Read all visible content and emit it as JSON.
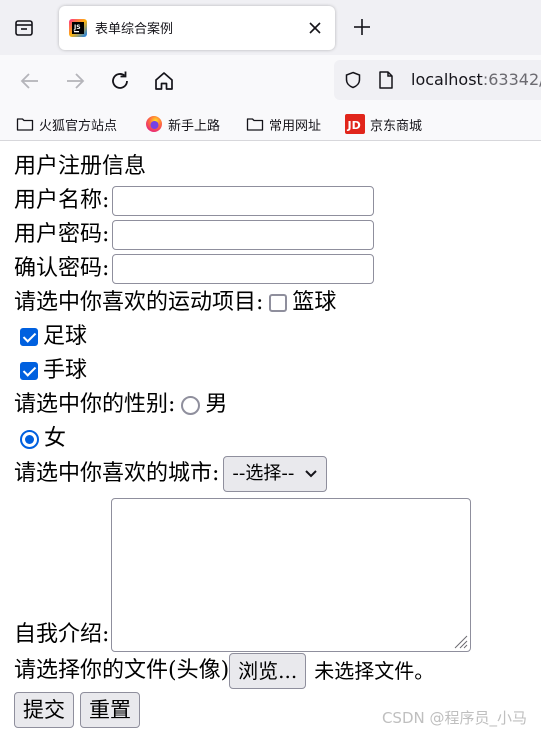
{
  "browser": {
    "tab_title": "表单综合案例",
    "url_host": "localhost",
    "url_rest": ":63342/",
    "bookmarks": [
      {
        "label": "火狐官方站点",
        "icon": "folder-icon"
      },
      {
        "label": "新手上路",
        "icon": "firefox-icon"
      },
      {
        "label": "常用网址",
        "icon": "folder-icon"
      },
      {
        "label": "京东商城",
        "icon": "jd-logo-icon"
      }
    ],
    "accent_color": "#0060df"
  },
  "form": {
    "heading": "用户注册信息",
    "username_label": "用户名称:",
    "username_value": "",
    "password_label": "用户密码:",
    "password_value": "",
    "confirm_label": "确认密码:",
    "confirm_value": "",
    "sports_label": "请选中你喜欢的运动项目:",
    "sports": [
      {
        "label": "篮球",
        "checked": false
      },
      {
        "label": "足球",
        "checked": true
      },
      {
        "label": "手球",
        "checked": true
      }
    ],
    "gender_label": "请选中你的性别:",
    "genders": [
      {
        "label": "男",
        "checked": false
      },
      {
        "label": "女",
        "checked": true
      }
    ],
    "city_label": "请选中你喜欢的城市:",
    "city_selected": "--选择--",
    "intro_label": "自我介绍:",
    "intro_value": "",
    "file_label": "请选择你的文件(头像)",
    "browse_label": "浏览...",
    "file_status": "未选择文件。",
    "submit_label": "提交",
    "reset_label": "重置"
  },
  "watermark": "CSDN @程序员_小马"
}
